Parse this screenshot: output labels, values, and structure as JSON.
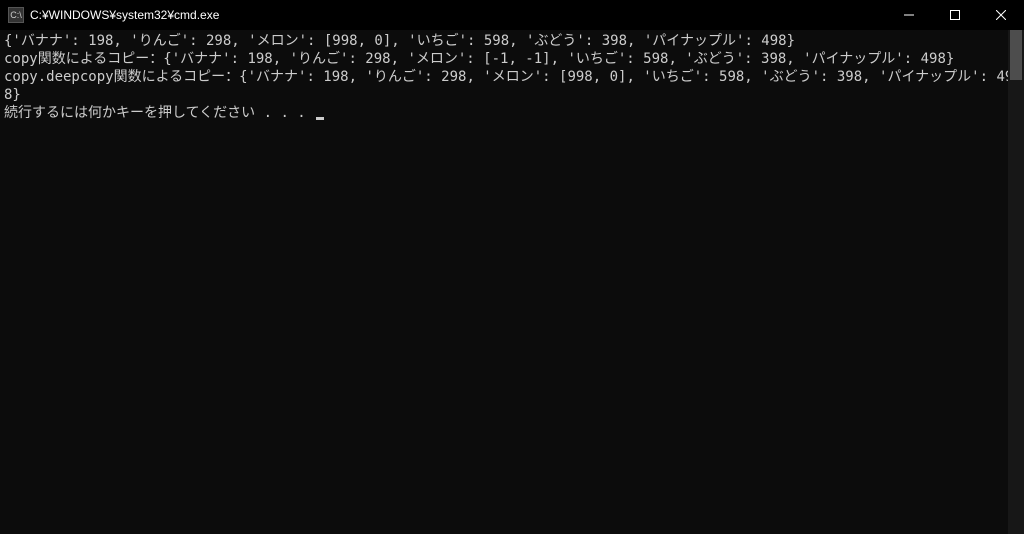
{
  "titlebar": {
    "icon_label": "C:\\",
    "title": "C:¥WINDOWS¥system32¥cmd.exe"
  },
  "terminal": {
    "lines": [
      "{'バナナ': 198, 'りんご': 298, 'メロン': [998, 0], 'いちご': 598, 'ぶどう': 398, 'パイナップル': 498}",
      "copy関数によるコピー：{'バナナ': 198, 'りんご': 298, 'メロン': [-1, -1], 'いちご': 598, 'ぶどう': 398, 'パイナップル': 498}",
      "copy.deepcopy関数によるコピー：{'バナナ': 198, 'りんご': 298, 'メロン': [998, 0], 'いちご': 598, 'ぶどう': 398, 'パイナップル': 498}",
      "続行するには何かキーを押してください . . . "
    ]
  }
}
